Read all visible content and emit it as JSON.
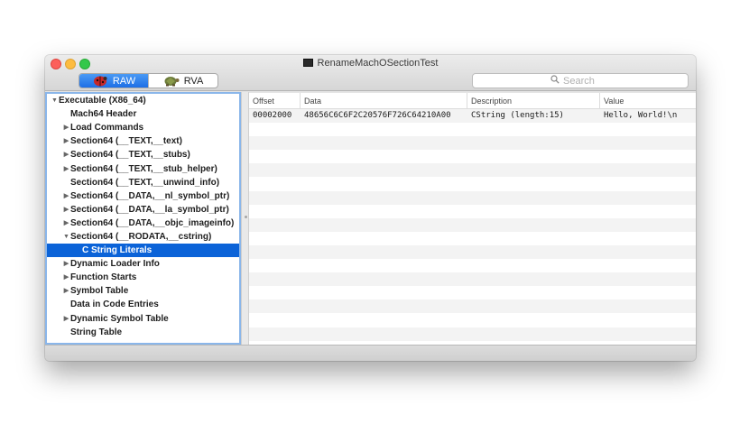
{
  "window": {
    "title": "RenameMachOSectionTest"
  },
  "toolbar": {
    "segments": [
      {
        "label": "RAW",
        "icon": "ladybug-icon",
        "active": true
      },
      {
        "label": "RVA",
        "icon": "turtle-icon",
        "active": false
      }
    ],
    "search": {
      "placeholder": "Search",
      "value": ""
    }
  },
  "sidebar": {
    "items": [
      {
        "label": "Executable  (X86_64)",
        "level": 0,
        "disclosure": "expanded",
        "selected": false
      },
      {
        "label": "Mach64 Header",
        "level": 1,
        "disclosure": "none",
        "selected": false
      },
      {
        "label": "Load Commands",
        "level": 1,
        "disclosure": "collapsed",
        "selected": false
      },
      {
        "label": "Section64 (__TEXT,__text)",
        "level": 1,
        "disclosure": "collapsed",
        "selected": false
      },
      {
        "label": "Section64 (__TEXT,__stubs)",
        "level": 1,
        "disclosure": "collapsed",
        "selected": false
      },
      {
        "label": "Section64 (__TEXT,__stub_helper)",
        "level": 1,
        "disclosure": "collapsed",
        "selected": false
      },
      {
        "label": "Section64 (__TEXT,__unwind_info)",
        "level": 1,
        "disclosure": "none",
        "selected": false
      },
      {
        "label": "Section64 (__DATA,__nl_symbol_ptr)",
        "level": 1,
        "disclosure": "collapsed",
        "selected": false
      },
      {
        "label": "Section64 (__DATA,__la_symbol_ptr)",
        "level": 1,
        "disclosure": "collapsed",
        "selected": false
      },
      {
        "label": "Section64 (__DATA,__objc_imageinfo)",
        "level": 1,
        "disclosure": "collapsed",
        "selected": false
      },
      {
        "label": "Section64 (__RODATA,__cstring)",
        "level": 1,
        "disclosure": "expanded",
        "selected": false
      },
      {
        "label": "C String Literals",
        "level": 2,
        "disclosure": "none",
        "selected": true
      },
      {
        "label": "Dynamic Loader Info",
        "level": 1,
        "disclosure": "collapsed",
        "selected": false
      },
      {
        "label": "Function Starts",
        "level": 1,
        "disclosure": "collapsed",
        "selected": false
      },
      {
        "label": "Symbol Table",
        "level": 1,
        "disclosure": "collapsed",
        "selected": false
      },
      {
        "label": "Data in Code Entries",
        "level": 1,
        "disclosure": "none",
        "selected": false
      },
      {
        "label": "Dynamic Symbol Table",
        "level": 1,
        "disclosure": "collapsed",
        "selected": false
      },
      {
        "label": "String Table",
        "level": 1,
        "disclosure": "none",
        "selected": false
      }
    ]
  },
  "table": {
    "columns": [
      "Offset",
      "Data",
      "Description",
      "Value"
    ],
    "rows": [
      [
        "00002000",
        "48656C6C6F2C20576F726C64210A00",
        "CString (length:15)",
        "Hello, World!\\n"
      ]
    ]
  },
  "colors": {
    "selection": "#0b63d8",
    "segment_active": "#1d6fe6",
    "sidebar_focus_ring": "#8ab6ea"
  }
}
